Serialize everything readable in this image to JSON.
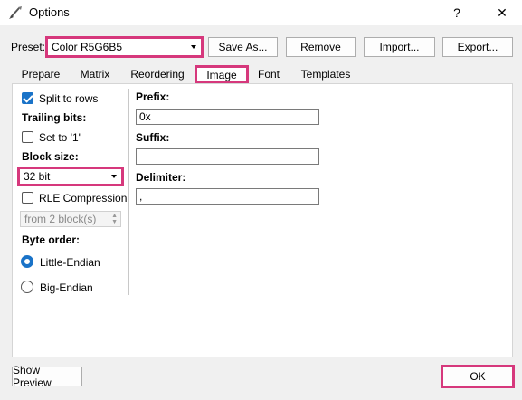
{
  "window": {
    "title": "Options",
    "help_label": "?",
    "close_label": "✕"
  },
  "preset": {
    "label": "Preset:",
    "value": "Color R5G6B5"
  },
  "toolbar": {
    "save_as": "Save As...",
    "remove": "Remove",
    "import": "Import...",
    "export": "Export..."
  },
  "tabs": [
    "Prepare",
    "Matrix",
    "Reordering",
    "Image",
    "Font",
    "Templates"
  ],
  "left": {
    "split_rows": "Split to rows",
    "trailing_bits": "Trailing bits:",
    "set_to_1": "Set to '1'",
    "block_size": "Block size:",
    "block_size_value": "32 bit",
    "rle": "RLE Compression",
    "from_blocks": "from 2 block(s)",
    "byte_order": "Byte order:",
    "little_endian": "Little-Endian",
    "big_endian": "Big-Endian"
  },
  "right": {
    "prefix_label": "Prefix:",
    "prefix_value": "0x",
    "suffix_label": "Suffix:",
    "suffix_value": "",
    "delimiter_label": "Delimiter:",
    "delimiter_value": ","
  },
  "footer": {
    "show_preview": "Show Preview",
    "ok": "OK"
  },
  "colors": {
    "highlight": "#d6387c",
    "accent": "#1a73c8"
  }
}
